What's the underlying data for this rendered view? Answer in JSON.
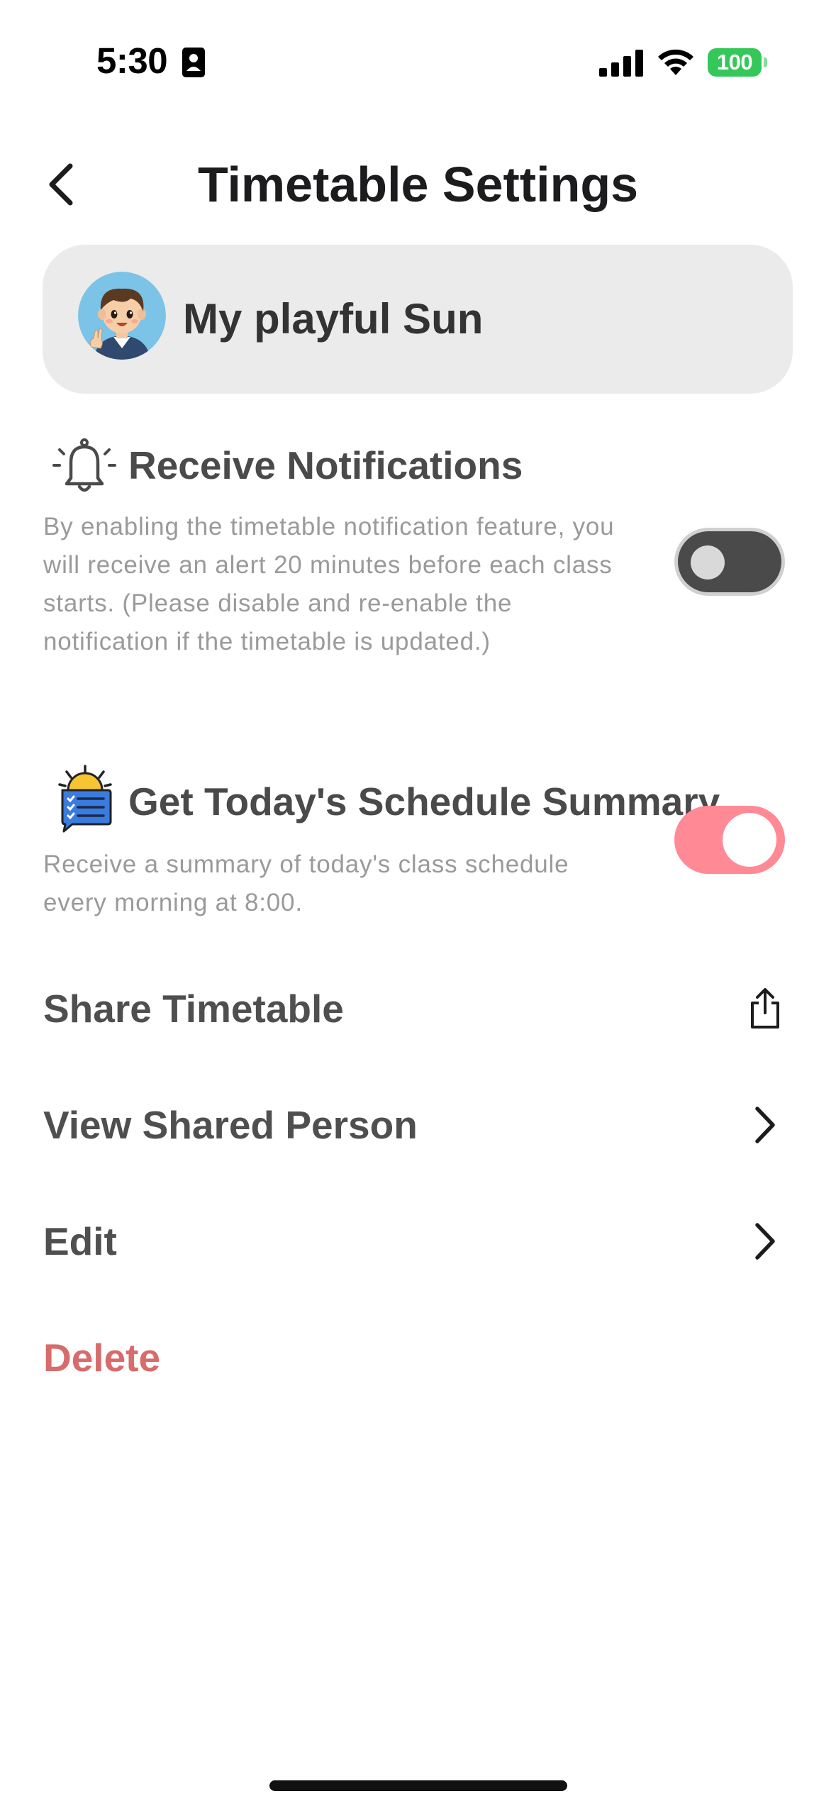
{
  "status_bar": {
    "time": "5:30",
    "battery": "100",
    "icons": [
      "contact-card-icon",
      "cellular-signal-icon",
      "wifi-icon",
      "battery-icon"
    ]
  },
  "header": {
    "title": "Timetable Settings",
    "back_icon": "chevron-left-icon"
  },
  "profile": {
    "name": "My playful Sun",
    "avatar_icon": "cartoon-boy-avatar"
  },
  "notifications": {
    "icon": "bell-icon",
    "title": "Receive Notifications",
    "description": "By enabling the timetable notification feature, you will receive an alert 20 minutes before each class starts. (Please disable and re-enable the notification if the timetable is updated.)",
    "enabled": false
  },
  "summary": {
    "icon": "sun-checklist-icon",
    "title": "Get Today's Schedule Summary",
    "description": "Receive a summary of today's class schedule every morning at 8:00.",
    "enabled": true
  },
  "menu": {
    "share": {
      "label": "Share Timetable",
      "icon": "share-icon"
    },
    "view_shared": {
      "label": "View Shared Person",
      "icon": "chevron-right-icon"
    },
    "edit": {
      "label": "Edit",
      "icon": "chevron-right-icon"
    },
    "delete": {
      "label": "Delete"
    }
  },
  "colors": {
    "accent_toggle_on": "#ff8a95",
    "toggle_off": "#4a4a4a",
    "danger": "#d86b6b",
    "battery": "#34c759",
    "card_bg": "#ebebeb"
  }
}
